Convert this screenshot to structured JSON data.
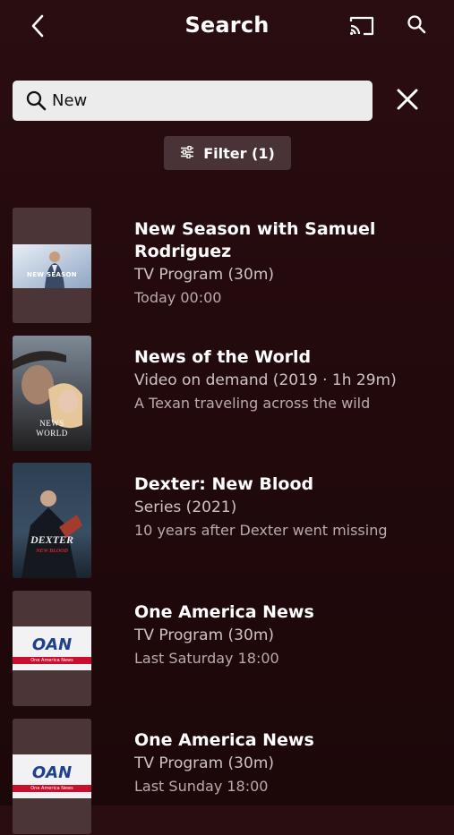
{
  "header": {
    "title": "Search"
  },
  "search": {
    "value": "New"
  },
  "filter": {
    "label": "Filter (1)"
  },
  "results": [
    {
      "title": "New Season with Samuel Rodriguez",
      "subtitle": "TV Program (30m)",
      "meta": "Today 00:00"
    },
    {
      "title": "News of the World",
      "subtitle": "Video on demand (2019 · 1h 29m)",
      "meta": "A Texan traveling across the wild"
    },
    {
      "title": "Dexter: New Blood",
      "subtitle": "Series (2021)",
      "meta": "10 years after Dexter went missing"
    },
    {
      "title": "One America News",
      "subtitle": "TV Program (30m)",
      "meta": "Last Saturday 18:00"
    },
    {
      "title": "One America News",
      "subtitle": "TV Program (30m)",
      "meta": "Last Sunday 18:00"
    }
  ],
  "thumb_text": {
    "nw_line1": "NEWS",
    "nw_line2": "WORLD",
    "dexter_line1": "DEXTER",
    "dexter_line2": "NEW BLOOD",
    "oan": "OAN",
    "oan_small": "One America News",
    "ns": "NEW SEASON"
  },
  "icons": {
    "back": "chevron-left-icon",
    "cast": "cast-icon",
    "search": "search-icon",
    "clear": "close-icon",
    "filter": "sliders-icon"
  },
  "colors": {
    "background": "#230a0d",
    "search_box": "#ececec",
    "filter_bg": "#4a3336",
    "thumb_bg": "#4b3537",
    "oan_blue": "#1f3f8f",
    "oan_red": "#c8102e"
  }
}
